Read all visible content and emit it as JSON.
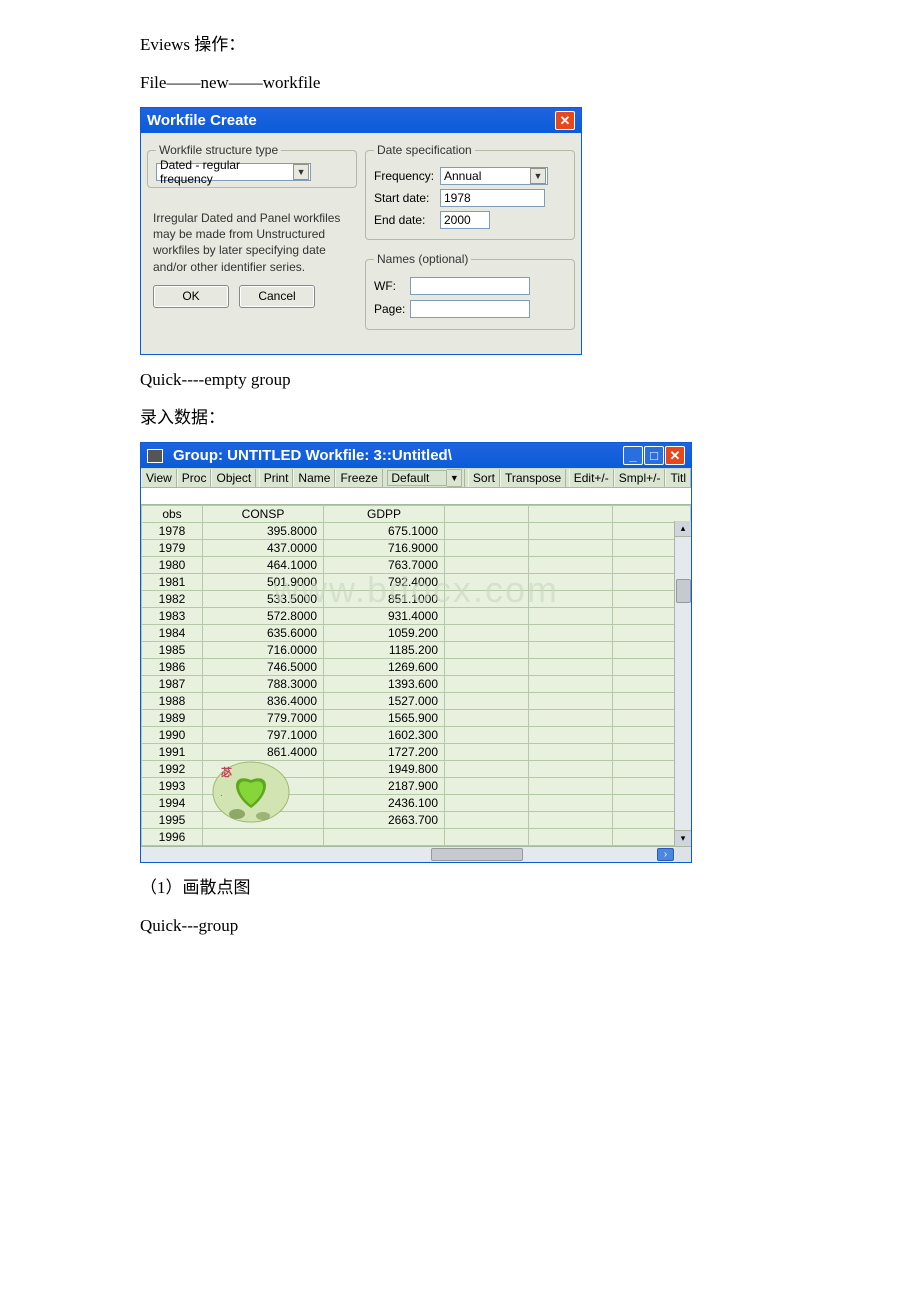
{
  "text": {
    "line1": "Eviews 操作：",
    "line2": "File——new——workfile",
    "line3": "Quick----empty group",
    "line4": "录入数据：",
    "line5": "（1）画散点图",
    "line6": "Quick---group"
  },
  "dialog1": {
    "title": "Workfile Create",
    "struct_legend": "Workfile structure type",
    "struct_value": "Dated - regular frequency",
    "note": "Irregular Dated and Panel workfiles may be made from Unstructured workfiles by later specifying date and/or other identifier series.",
    "ok": "OK",
    "cancel": "Cancel",
    "date_legend": "Date specification",
    "freq_label": "Frequency:",
    "freq_value": "Annual",
    "start_label": "Start date:",
    "start_value": "1978",
    "end_label": "End date:",
    "end_value": "2000",
    "names_legend": "Names (optional)",
    "wf_label": "WF:",
    "page_label": "Page:"
  },
  "group": {
    "title": "Group: UNTITLED   Workfile: 3::Untitled\\",
    "toolbar": [
      "View",
      "Proc",
      "Object",
      "Print",
      "Name",
      "Freeze"
    ],
    "combo": "Default",
    "toolbar2": [
      "Sort",
      "Transpose",
      "Edit+/-",
      "Smpl+/-",
      "Titl"
    ],
    "headers": [
      "obs",
      "CONSP",
      "GDPP"
    ],
    "watermark": "www.bdocx.com",
    "rows": [
      {
        "obs": "1978",
        "c1": "395.8000",
        "c2": "675.1000"
      },
      {
        "obs": "1979",
        "c1": "437.0000",
        "c2": "716.9000"
      },
      {
        "obs": "1980",
        "c1": "464.1000",
        "c2": "763.7000"
      },
      {
        "obs": "1981",
        "c1": "501.9000",
        "c2": "792.4000"
      },
      {
        "obs": "1982",
        "c1": "533.5000",
        "c2": "851.1000"
      },
      {
        "obs": "1983",
        "c1": "572.8000",
        "c2": "931.4000"
      },
      {
        "obs": "1984",
        "c1": "635.6000",
        "c2": "1059.200"
      },
      {
        "obs": "1985",
        "c1": "716.0000",
        "c2": "1185.200"
      },
      {
        "obs": "1986",
        "c1": "746.5000",
        "c2": "1269.600"
      },
      {
        "obs": "1987",
        "c1": "788.3000",
        "c2": "1393.600"
      },
      {
        "obs": "1988",
        "c1": "836.4000",
        "c2": "1527.000"
      },
      {
        "obs": "1989",
        "c1": "779.7000",
        "c2": "1565.900"
      },
      {
        "obs": "1990",
        "c1": "797.1000",
        "c2": "1602.300"
      },
      {
        "obs": "1991",
        "c1": "861.4000",
        "c2": "1727.200"
      },
      {
        "obs": "1992",
        "c1": "",
        "c2": "1949.800"
      },
      {
        "obs": "1993",
        "c1": "",
        "c2": "2187.900"
      },
      {
        "obs": "1994",
        "c1": "",
        "c2": "2436.100"
      },
      {
        "obs": "1995",
        "c1": "",
        "c2": "2663.700"
      },
      {
        "obs": "1996",
        "c1": "",
        "c2": ""
      }
    ]
  }
}
